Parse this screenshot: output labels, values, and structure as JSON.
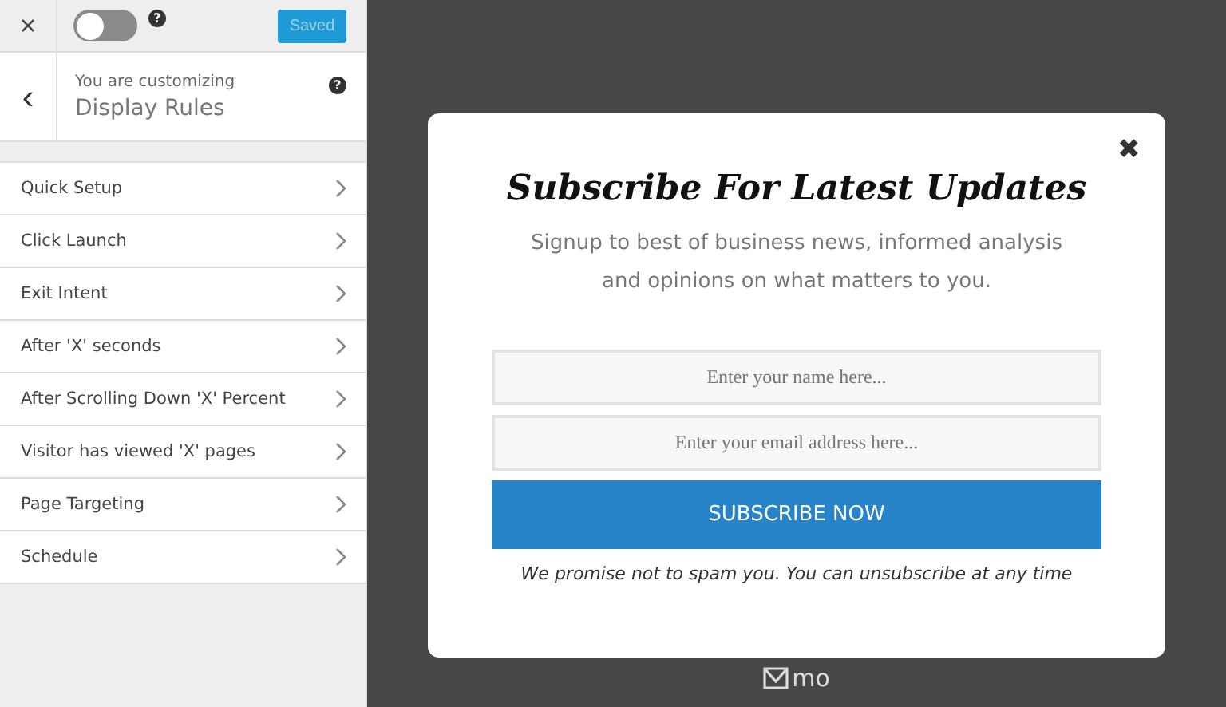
{
  "top_bar": {
    "close": "×",
    "toggle": {
      "on": false
    },
    "help": "?",
    "save_button": {
      "label": "Saved",
      "disabled": true
    }
  },
  "header": {
    "back": "‹",
    "subtitle": "You are customizing",
    "title": "Display Rules",
    "help": "?"
  },
  "menu": [
    {
      "label": "Quick Setup"
    },
    {
      "label": "Click Launch"
    },
    {
      "label": "Exit Intent"
    },
    {
      "label": "After 'X' seconds"
    },
    {
      "label": "After Scrolling Down 'X' Percent"
    },
    {
      "label": "Visitor has viewed 'X' pages"
    },
    {
      "label": "Page Targeting"
    },
    {
      "label": "Schedule"
    }
  ],
  "popup": {
    "close": "✖",
    "title": "Subscribe For Latest Updates",
    "description": "Signup to best of business news, informed analysis and opinions on what matters to you.",
    "fields": [
      {
        "placeholder": "Enter your name here..."
      },
      {
        "placeholder": "Enter your email address here..."
      }
    ],
    "button": "SUBSCRIBE NOW",
    "note": "We promise not to spam you. You can unsubscribe at any time"
  },
  "brand": "mo"
}
